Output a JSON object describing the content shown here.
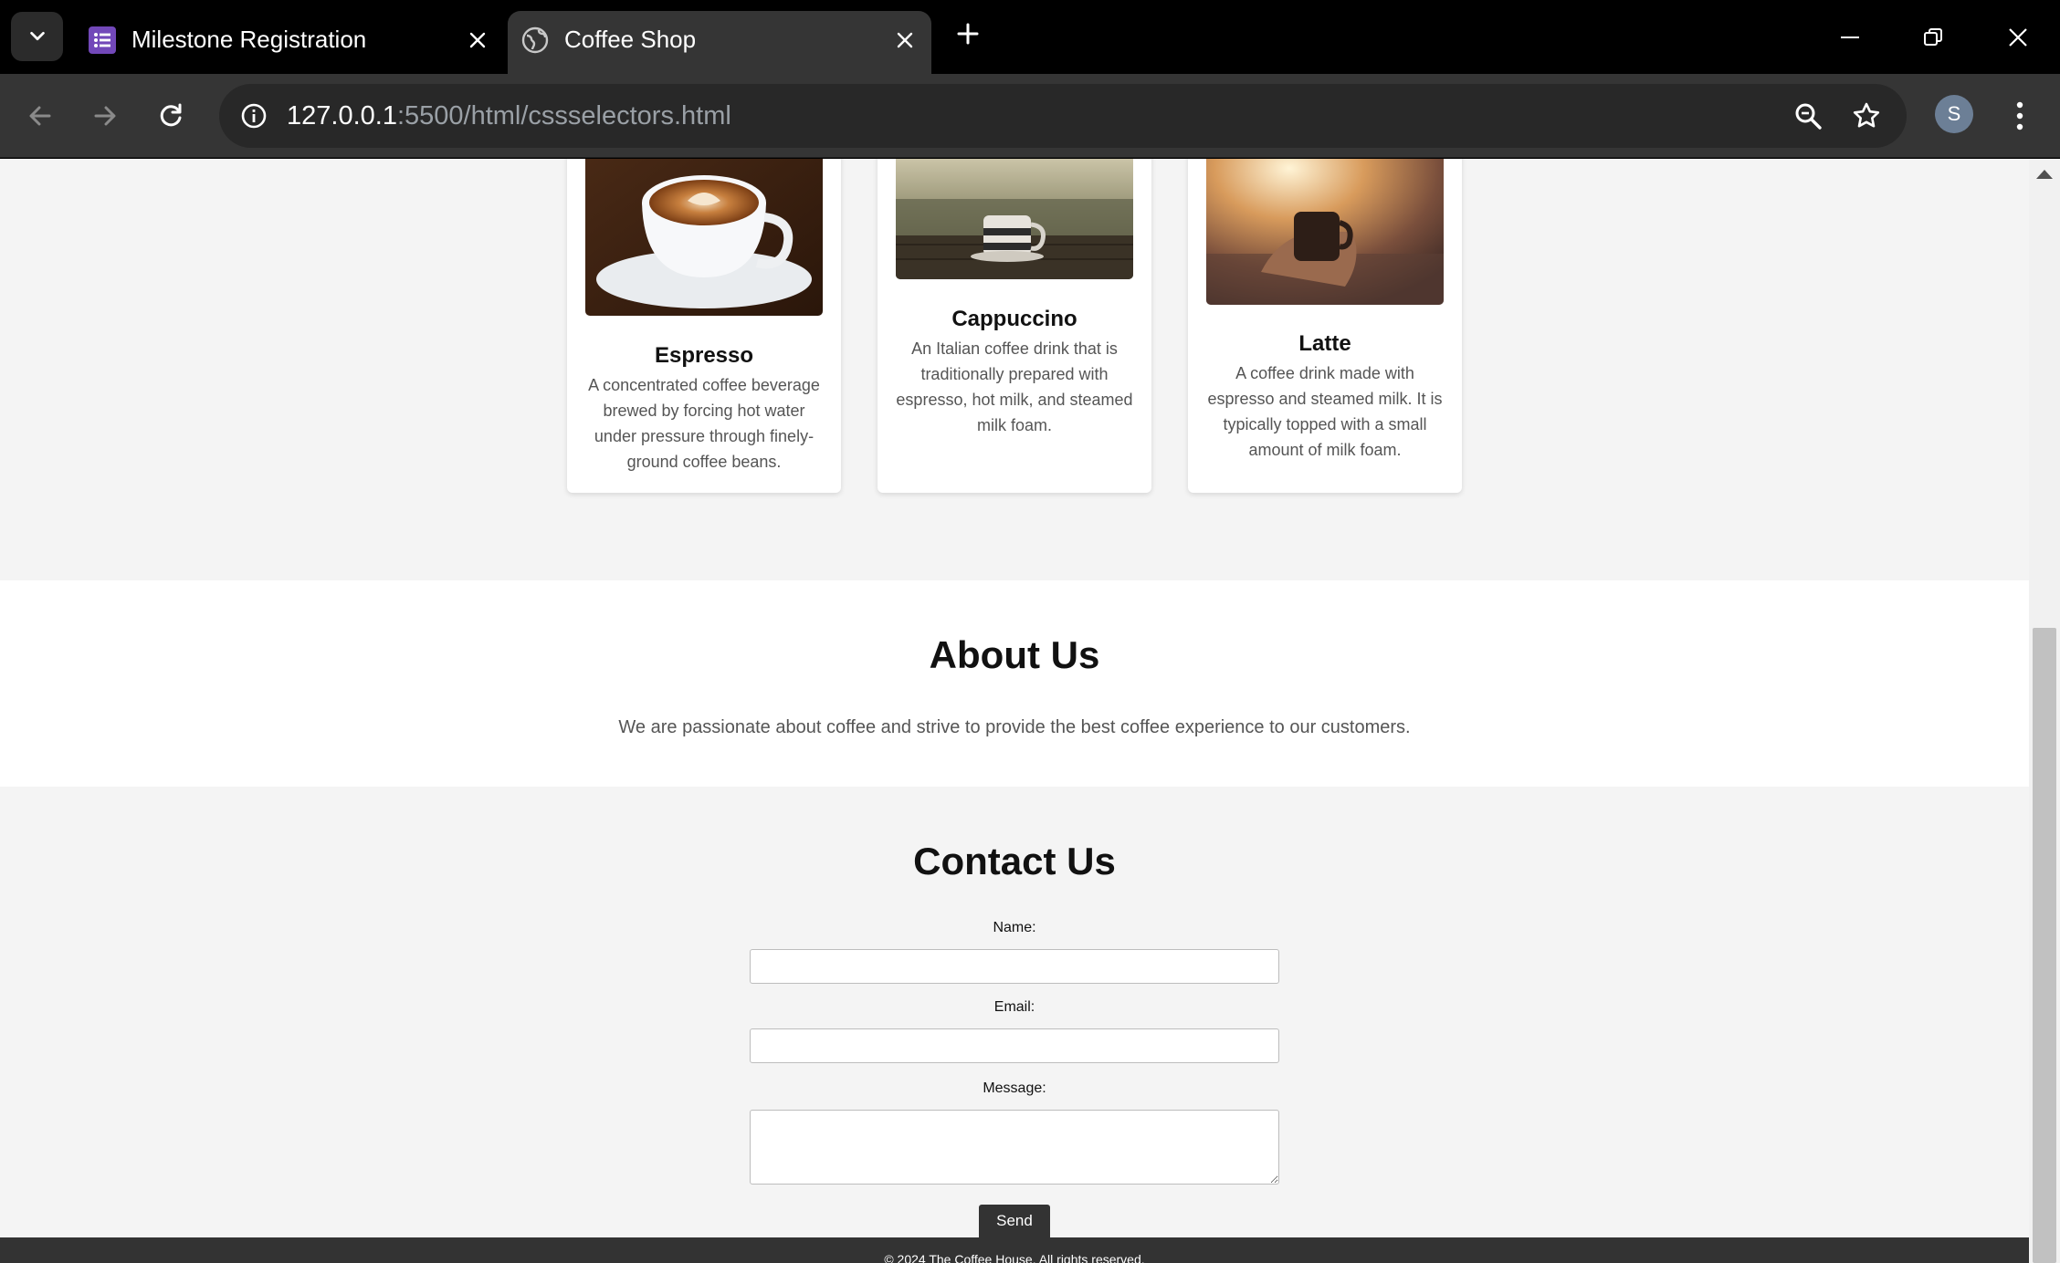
{
  "browser": {
    "tabs": [
      {
        "title": "Milestone Registration",
        "active": false,
        "favicon": "forms-list-icon"
      },
      {
        "title": "Coffee Shop",
        "active": true,
        "favicon": "globe-icon"
      }
    ],
    "url_host": "127.0.0.1",
    "url_rest": ":5500/html/cssselectors.html",
    "profile_initial": "S"
  },
  "menu": {
    "items": [
      {
        "name": "Espresso",
        "description": "A concentrated coffee beverage brewed by forcing hot water under pressure through finely-ground coffee beans."
      },
      {
        "name": "Cappuccino",
        "description": "An Italian coffee drink that is traditionally prepared with espresso, hot milk, and steamed milk foam."
      },
      {
        "name": "Latte",
        "description": "A coffee drink made with espresso and steamed milk. It is typically topped with a small amount of milk foam."
      }
    ]
  },
  "about": {
    "title": "About Us",
    "text": "We are passionate about coffee and strive to provide the best coffee experience to our customers."
  },
  "contact": {
    "title": "Contact Us",
    "name_label": "Name:",
    "email_label": "Email:",
    "message_label": "Message:",
    "send_label": "Send"
  },
  "footer": {
    "text": "© 2024 The Coffee House. All rights reserved."
  },
  "colors": {
    "page_bg": "#f4f4f4",
    "footer_bg": "#333333",
    "button_bg": "#333333",
    "chrome_tab_active": "#353535",
    "chrome_bar": "#000000",
    "favicon_forms": "#7248b9"
  }
}
